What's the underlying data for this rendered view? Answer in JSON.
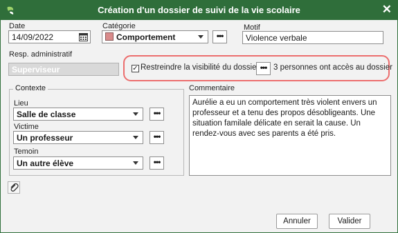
{
  "dialog": {
    "title": "Création d'un dossier de suivi de la vie scolaire",
    "close_glyph": "✕"
  },
  "date": {
    "label": "Date",
    "value": "14/09/2022"
  },
  "categorie": {
    "label": "Catégorie",
    "value": "Comportement",
    "swatch_color": "#d98b8b"
  },
  "motif": {
    "label": "Motif",
    "value": "Violence verbale"
  },
  "resp": {
    "label": "Resp. administratif",
    "value": "Superviseur"
  },
  "visibility": {
    "checked": true,
    "label": "Restreindre la visibilité du dossier",
    "access_text": "3 personnes ont accès au dossier"
  },
  "contexte": {
    "title": "Contexte",
    "lieu": {
      "label": "Lieu",
      "value": "Salle de classe"
    },
    "victime": {
      "label": "Victime",
      "value": "Un professeur"
    },
    "temoin": {
      "label": "Temoin",
      "value": "Un autre élève"
    }
  },
  "commentaire": {
    "label": "Commentaire",
    "text": "Aurélie a eu un comportement très violent envers un professeur et a tenu des propos désobligeants. Une situation familale délicate en serait la cause. Un rendez-vous avec ses parents a été pris."
  },
  "buttons": {
    "cancel": "Annuler",
    "ok": "Valider"
  },
  "more_glyph": "•••",
  "colors": {
    "titlebar": "#2f6e3a",
    "highlight": "#ec6d6d"
  },
  "icons": {
    "logo": "app-logo-icon",
    "calendar": "calendar-icon",
    "attach": "paperclip-icon"
  }
}
